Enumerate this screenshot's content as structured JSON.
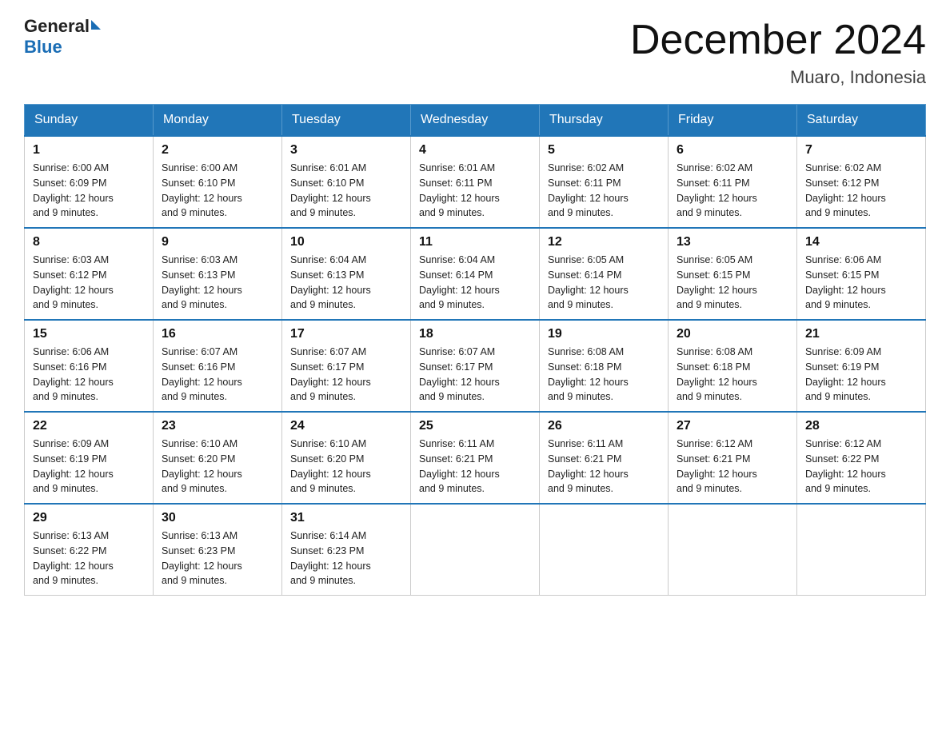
{
  "header": {
    "logo_general": "General",
    "logo_blue": "Blue",
    "title": "December 2024",
    "subtitle": "Muaro, Indonesia"
  },
  "days_of_week": [
    "Sunday",
    "Monday",
    "Tuesday",
    "Wednesday",
    "Thursday",
    "Friday",
    "Saturday"
  ],
  "weeks": [
    [
      {
        "day": "1",
        "sunrise": "6:00 AM",
        "sunset": "6:09 PM",
        "daylight": "12 hours and 9 minutes."
      },
      {
        "day": "2",
        "sunrise": "6:00 AM",
        "sunset": "6:10 PM",
        "daylight": "12 hours and 9 minutes."
      },
      {
        "day": "3",
        "sunrise": "6:01 AM",
        "sunset": "6:10 PM",
        "daylight": "12 hours and 9 minutes."
      },
      {
        "day": "4",
        "sunrise": "6:01 AM",
        "sunset": "6:11 PM",
        "daylight": "12 hours and 9 minutes."
      },
      {
        "day": "5",
        "sunrise": "6:02 AM",
        "sunset": "6:11 PM",
        "daylight": "12 hours and 9 minutes."
      },
      {
        "day": "6",
        "sunrise": "6:02 AM",
        "sunset": "6:11 PM",
        "daylight": "12 hours and 9 minutes."
      },
      {
        "day": "7",
        "sunrise": "6:02 AM",
        "sunset": "6:12 PM",
        "daylight": "12 hours and 9 minutes."
      }
    ],
    [
      {
        "day": "8",
        "sunrise": "6:03 AM",
        "sunset": "6:12 PM",
        "daylight": "12 hours and 9 minutes."
      },
      {
        "day": "9",
        "sunrise": "6:03 AM",
        "sunset": "6:13 PM",
        "daylight": "12 hours and 9 minutes."
      },
      {
        "day": "10",
        "sunrise": "6:04 AM",
        "sunset": "6:13 PM",
        "daylight": "12 hours and 9 minutes."
      },
      {
        "day": "11",
        "sunrise": "6:04 AM",
        "sunset": "6:14 PM",
        "daylight": "12 hours and 9 minutes."
      },
      {
        "day": "12",
        "sunrise": "6:05 AM",
        "sunset": "6:14 PM",
        "daylight": "12 hours and 9 minutes."
      },
      {
        "day": "13",
        "sunrise": "6:05 AM",
        "sunset": "6:15 PM",
        "daylight": "12 hours and 9 minutes."
      },
      {
        "day": "14",
        "sunrise": "6:06 AM",
        "sunset": "6:15 PM",
        "daylight": "12 hours and 9 minutes."
      }
    ],
    [
      {
        "day": "15",
        "sunrise": "6:06 AM",
        "sunset": "6:16 PM",
        "daylight": "12 hours and 9 minutes."
      },
      {
        "day": "16",
        "sunrise": "6:07 AM",
        "sunset": "6:16 PM",
        "daylight": "12 hours and 9 minutes."
      },
      {
        "day": "17",
        "sunrise": "6:07 AM",
        "sunset": "6:17 PM",
        "daylight": "12 hours and 9 minutes."
      },
      {
        "day": "18",
        "sunrise": "6:07 AM",
        "sunset": "6:17 PM",
        "daylight": "12 hours and 9 minutes."
      },
      {
        "day": "19",
        "sunrise": "6:08 AM",
        "sunset": "6:18 PM",
        "daylight": "12 hours and 9 minutes."
      },
      {
        "day": "20",
        "sunrise": "6:08 AM",
        "sunset": "6:18 PM",
        "daylight": "12 hours and 9 minutes."
      },
      {
        "day": "21",
        "sunrise": "6:09 AM",
        "sunset": "6:19 PM",
        "daylight": "12 hours and 9 minutes."
      }
    ],
    [
      {
        "day": "22",
        "sunrise": "6:09 AM",
        "sunset": "6:19 PM",
        "daylight": "12 hours and 9 minutes."
      },
      {
        "day": "23",
        "sunrise": "6:10 AM",
        "sunset": "6:20 PM",
        "daylight": "12 hours and 9 minutes."
      },
      {
        "day": "24",
        "sunrise": "6:10 AM",
        "sunset": "6:20 PM",
        "daylight": "12 hours and 9 minutes."
      },
      {
        "day": "25",
        "sunrise": "6:11 AM",
        "sunset": "6:21 PM",
        "daylight": "12 hours and 9 minutes."
      },
      {
        "day": "26",
        "sunrise": "6:11 AM",
        "sunset": "6:21 PM",
        "daylight": "12 hours and 9 minutes."
      },
      {
        "day": "27",
        "sunrise": "6:12 AM",
        "sunset": "6:21 PM",
        "daylight": "12 hours and 9 minutes."
      },
      {
        "day": "28",
        "sunrise": "6:12 AM",
        "sunset": "6:22 PM",
        "daylight": "12 hours and 9 minutes."
      }
    ],
    [
      {
        "day": "29",
        "sunrise": "6:13 AM",
        "sunset": "6:22 PM",
        "daylight": "12 hours and 9 minutes."
      },
      {
        "day": "30",
        "sunrise": "6:13 AM",
        "sunset": "6:23 PM",
        "daylight": "12 hours and 9 minutes."
      },
      {
        "day": "31",
        "sunrise": "6:14 AM",
        "sunset": "6:23 PM",
        "daylight": "12 hours and 9 minutes."
      },
      null,
      null,
      null,
      null
    ]
  ],
  "labels": {
    "sunrise": "Sunrise:",
    "sunset": "Sunset:",
    "daylight": "Daylight:"
  }
}
